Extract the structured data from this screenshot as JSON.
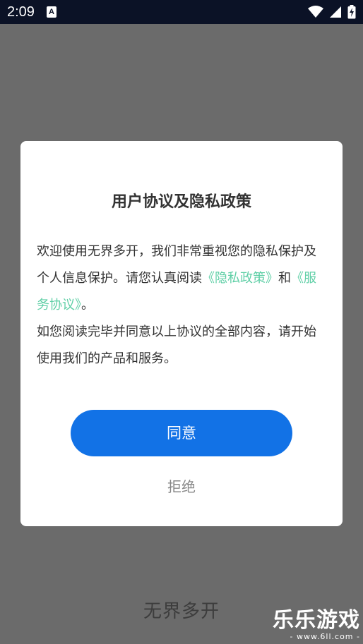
{
  "status_bar": {
    "time": "2:09",
    "notification_badge": "A",
    "icons": [
      "wifi-icon",
      "signal-icon",
      "battery-icon"
    ]
  },
  "background": {
    "app_name": "无界多开"
  },
  "dialog": {
    "title": "用户协议及隐私政策",
    "body_intro": "欢迎使用无界多开，我们非常重视您的隐私保护及个人信息保护。请您认真阅读",
    "privacy_link": "《隐私政策》",
    "connector": "和",
    "service_link": "《服务协议》",
    "period": "。",
    "body_second": "如您阅读完毕并同意以上协议的全部内容，请开始使用我们的产品和服务。",
    "agree_label": "同意",
    "refuse_label": "拒绝"
  },
  "watermark": {
    "main": "乐乐游戏",
    "sub": "- www.6ll.com -"
  },
  "colors": {
    "overlay": "#6b6b6b",
    "status_bar": "#0b1226",
    "accent_button": "#1272e6",
    "link": "#5fcfa6"
  }
}
